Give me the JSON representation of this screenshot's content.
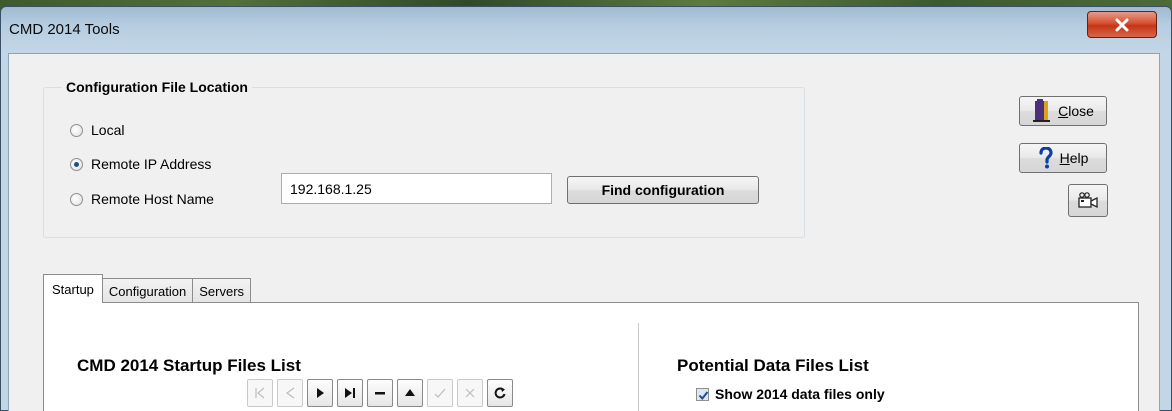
{
  "window": {
    "title": "CMD 2014 Tools"
  },
  "config_group": {
    "legend": "Configuration File Location",
    "options": [
      {
        "label": "Local",
        "checked": false
      },
      {
        "label": "Remote IP Address",
        "checked": true
      },
      {
        "label": "Remote Host Name",
        "checked": false
      }
    ],
    "address_value": "192.168.1.25",
    "find_button": "Find configuration"
  },
  "side_buttons": {
    "close_label": "Close",
    "close_mnemonic": "C",
    "close_rest": "lose",
    "help_label": "Help",
    "help_mnemonic": "H",
    "help_rest": "elp"
  },
  "tabs": [
    {
      "label": "Startup",
      "active": true
    },
    {
      "label": "Configuration",
      "active": false
    },
    {
      "label": "Servers",
      "active": false
    }
  ],
  "startup_panel": {
    "left_title": "CMD 2014 Startup Files List",
    "right_title": "Potential Data Files List",
    "checkbox_label": "Show 2014 data files only",
    "checkbox_checked": true
  },
  "icons": {
    "close_window": "close-x-icon",
    "close_button": "door-exit-icon",
    "help_button": "question-mark-icon",
    "camera_button": "camera-icon",
    "toolbar": [
      "first-record-icon",
      "prior-record-icon",
      "next-record-icon",
      "last-record-icon",
      "delete-record-icon",
      "insert-record-icon",
      "post-edit-icon",
      "cancel-edit-icon",
      "refresh-icon"
    ]
  },
  "colors": {
    "accent": "#1f4f87",
    "close_red": "#c53517",
    "help_blue": "#0c3fa6",
    "door_purple": "#4b2f7a"
  }
}
